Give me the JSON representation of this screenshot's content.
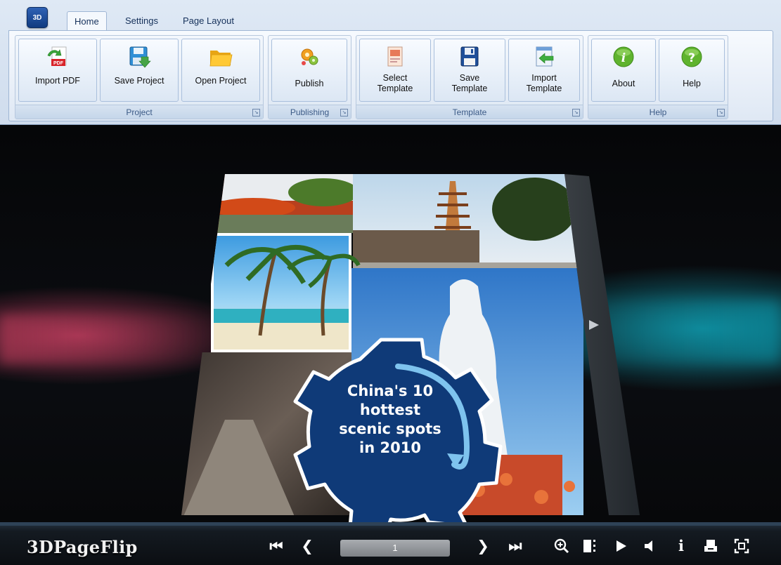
{
  "app": {
    "icon_text": "3D"
  },
  "tabs": [
    {
      "label": "Home",
      "active": true
    },
    {
      "label": "Settings",
      "active": false
    },
    {
      "label": "Page Layout",
      "active": false
    }
  ],
  "ribbon": {
    "groups": {
      "project": "Project",
      "publishing": "Publishing",
      "template": "Template",
      "help": "Help"
    },
    "buttons": {
      "import_pdf": "Import PDF",
      "save_project": "Save Project",
      "open_project": "Open Project",
      "publish": "Publish",
      "select_template_1": "Select",
      "select_template_2": "Template",
      "save_template_1": "Save",
      "save_template_2": "Template",
      "import_template_1": "Import",
      "import_template_2": "Template",
      "about": "About",
      "help": "Help"
    },
    "pdf_badge": "PDF"
  },
  "book": {
    "headline_lines": [
      "China's 10",
      "hottest",
      "scenic spots",
      "in 2010"
    ]
  },
  "toolbar": {
    "brand": "3DPageFlip",
    "page_number": "1",
    "icons": [
      "first-page-icon",
      "previous-page-icon",
      "next-page-icon",
      "last-page-icon",
      "zoom-in-icon",
      "thumbnails-icon",
      "autoplay-icon",
      "sound-icon",
      "info-icon",
      "print-icon",
      "fullscreen-icon"
    ]
  },
  "colors": {
    "ribbon_bg": "#dfe9f5",
    "stage_bg": "#0b0d11",
    "gear_blue": "#0f3a78",
    "arrow_light_blue": "#7ec3ee",
    "toolbar_bg": "#0b0e12"
  }
}
